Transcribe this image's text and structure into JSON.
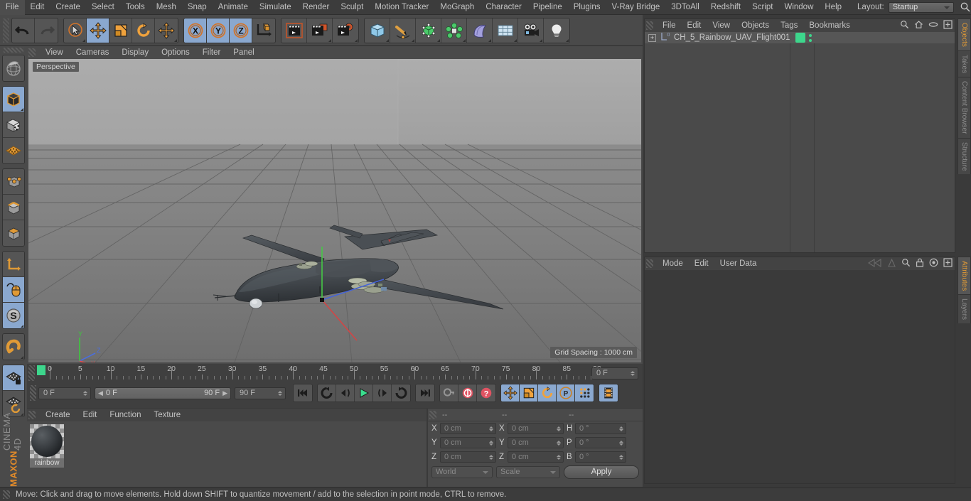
{
  "app": {
    "name": "MAXON CINEMA 4D",
    "brand_primary": "MAXON",
    "brand_secondary": "CINEMA 4D"
  },
  "menubar": {
    "items": [
      "File",
      "Edit",
      "Create",
      "Select",
      "Tools",
      "Mesh",
      "Snap",
      "Animate",
      "Simulate",
      "Render",
      "Sculpt",
      "Motion Tracker",
      "MoGraph",
      "Character",
      "Pipeline",
      "Plugins",
      "V-Ray Bridge",
      "3DToAll",
      "Redshift",
      "Script",
      "Window",
      "Help"
    ],
    "layout_label": "Layout:",
    "layout_value": "Startup",
    "search_icon": "search-icon"
  },
  "toolbar": {
    "groups": [
      {
        "name": "undo-redo",
        "buttons": [
          {
            "name": "undo-button",
            "icon": "undo-arrow-icon",
            "active": false
          },
          {
            "name": "redo-button",
            "icon": "redo-arrow-icon",
            "active": false
          }
        ]
      },
      {
        "name": "transform-tools",
        "buttons": [
          {
            "name": "live-selection-tool",
            "icon": "cursor-circle-icon",
            "active": false
          },
          {
            "name": "move-tool",
            "icon": "move-arrows-icon",
            "active": true
          },
          {
            "name": "scale-tool",
            "icon": "scale-box-icon",
            "active": false
          },
          {
            "name": "rotate-tool",
            "icon": "rotate-arc-icon",
            "active": false
          },
          {
            "name": "move-duplicate-tool",
            "icon": "move-arrows-icon",
            "active": false
          }
        ]
      },
      {
        "name": "axis-locks",
        "buttons": [
          {
            "name": "x-axis-lock",
            "icon": "x-circle-icon",
            "active": true
          },
          {
            "name": "y-axis-lock",
            "icon": "y-circle-icon",
            "active": true
          },
          {
            "name": "z-axis-lock",
            "icon": "z-circle-icon",
            "active": true
          },
          {
            "name": "world-object-coordinate-toggle",
            "icon": "axis-cube-icon",
            "active": false
          }
        ]
      },
      {
        "name": "render-tools",
        "buttons": [
          {
            "name": "render-view-button",
            "icon": "clapper-frame-icon",
            "active": false
          },
          {
            "name": "render-region-button",
            "icon": "clapper-region-icon",
            "active": false
          },
          {
            "name": "render-settings-button",
            "icon": "clapper-gear-icon",
            "active": false
          }
        ]
      },
      {
        "name": "create-objects",
        "buttons": [
          {
            "name": "add-primitive-cube-button",
            "icon": "blue-cube-icon",
            "active": false
          },
          {
            "name": "add-spline-button",
            "icon": "pen-spline-icon",
            "active": false
          },
          {
            "name": "add-generator-button",
            "icon": "green-cube-generator-icon",
            "active": false
          },
          {
            "name": "add-mograph-button",
            "icon": "green-cluster-icon",
            "active": false
          },
          {
            "name": "add-deformer-button",
            "icon": "purple-bend-icon",
            "active": false
          },
          {
            "name": "add-scene-object-button",
            "icon": "floor-grid-icon",
            "active": false
          },
          {
            "name": "add-camera-button",
            "icon": "camera-icon",
            "active": false
          },
          {
            "name": "add-light-button",
            "icon": "light-bulb-icon",
            "active": false
          }
        ]
      }
    ]
  },
  "leftbar": {
    "groups": [
      {
        "name": "render-preview",
        "buttons": [
          {
            "name": "interactive-render-region-button",
            "icon": "globe-sphere-icon",
            "active": false
          }
        ]
      },
      {
        "name": "mode-group-1",
        "buttons": [
          {
            "name": "object-mode-button",
            "icon": "dark-cube-icon",
            "active": true
          },
          {
            "name": "texture-mode-button",
            "icon": "checker-cube-icon",
            "active": false
          },
          {
            "name": "deformer-mode-button",
            "icon": "orange-grid-icon",
            "active": false
          }
        ]
      },
      {
        "name": "component-modes",
        "buttons": [
          {
            "name": "points-mode-button",
            "icon": "cube-points-icon",
            "active": false
          },
          {
            "name": "edges-mode-button",
            "icon": "cube-edges-icon",
            "active": false
          },
          {
            "name": "polygons-mode-button",
            "icon": "cube-polygon-icon",
            "active": false
          }
        ]
      },
      {
        "name": "axis-group",
        "buttons": [
          {
            "name": "enable-axis-modification-button",
            "icon": "axis-corner-icon",
            "active": false
          },
          {
            "name": "viewport-solo-button",
            "icon": "mouse-curve-icon",
            "active": true
          },
          {
            "name": "enable-snapping-button",
            "icon": "s-sphere-icon",
            "active": true
          }
        ]
      },
      {
        "name": "magnet-group",
        "buttons": [
          {
            "name": "magnet-tool-button",
            "icon": "magnet-icon",
            "active": false
          }
        ]
      },
      {
        "name": "workplane-group",
        "buttons": [
          {
            "name": "lock-workplane-button",
            "icon": "workplane-lock-icon",
            "active": true
          },
          {
            "name": "planar-workplane-button",
            "icon": "workplane-rotate-icon",
            "active": false
          }
        ]
      }
    ]
  },
  "viewport": {
    "menu_items": [
      "View",
      "Cameras",
      "Display",
      "Options",
      "Filter",
      "Panel"
    ],
    "view_label": "Perspective",
    "grid_spacing": "Grid Spacing : 1000 cm",
    "axis_gizmo": {
      "x": "X",
      "y": "Y",
      "z": "Z"
    },
    "scene_object": "UAV aircraft model"
  },
  "timeline": {
    "ruler_min": 0,
    "ruler_max": 90,
    "ruler_labels": [
      0,
      5,
      10,
      15,
      20,
      25,
      30,
      35,
      40,
      45,
      50,
      55,
      60,
      65,
      70,
      75,
      80,
      85,
      90
    ],
    "current_frame_field": "0 F",
    "preview_min": "0 F",
    "preview_max": "90 F",
    "end_frame_field": "90 F",
    "right_frame_field": "0 F",
    "playback_buttons": [
      {
        "name": "go-to-start-button",
        "icon": "skip-start-icon",
        "active": false
      },
      {
        "name": "go-to-previous-key-button",
        "icon": "prev-key-icon",
        "active": false
      },
      {
        "name": "step-back-button",
        "icon": "step-back-icon",
        "active": false
      },
      {
        "name": "play-button",
        "icon": "play-icon",
        "active": false
      },
      {
        "name": "step-forward-button",
        "icon": "step-forward-icon",
        "active": false
      },
      {
        "name": "go-to-next-key-button",
        "icon": "next-key-icon",
        "active": false
      },
      {
        "name": "go-to-end-button",
        "icon": "skip-end-icon",
        "active": false
      }
    ],
    "key_buttons": [
      {
        "name": "autokeying-button",
        "icon": "key-icon",
        "active": false
      },
      {
        "name": "record-active-objects-button",
        "icon": "record-circle-icon",
        "active": false
      },
      {
        "name": "keyframe-selection-button",
        "icon": "question-circle-icon",
        "active": false
      }
    ],
    "param_buttons": [
      {
        "name": "position-key-button",
        "icon": "move-arrows-icon",
        "active": true
      },
      {
        "name": "scale-key-button",
        "icon": "scale-box-icon",
        "active": true
      },
      {
        "name": "rotation-key-button",
        "icon": "rotate-arc-icon",
        "active": true
      },
      {
        "name": "parameter-key-button",
        "icon": "p-circle-icon",
        "active": true
      },
      {
        "name": "point-level-animation-button",
        "icon": "dots-grid-icon",
        "active": true
      }
    ],
    "extra_buttons": [
      {
        "name": "timeline-view-button",
        "icon": "filmstrip-icon",
        "active": true
      }
    ]
  },
  "material_manager": {
    "menu_items": [
      "Create",
      "Edit",
      "Function",
      "Texture"
    ],
    "materials": [
      {
        "name": "rainbow"
      }
    ]
  },
  "coordinates": {
    "headers": [
      "--",
      "--",
      "--"
    ],
    "rows": [
      {
        "label_a": "X",
        "value_a": "0 cm",
        "label_b": "X",
        "value_b": "0 cm",
        "label_c": "H",
        "value_c": "0 °"
      },
      {
        "label_a": "Y",
        "value_a": "0 cm",
        "label_b": "Y",
        "value_b": "0 cm",
        "label_c": "P",
        "value_c": "0 °"
      },
      {
        "label_a": "Z",
        "value_a": "0 cm",
        "label_b": "Z",
        "value_b": "0 cm",
        "label_c": "B",
        "value_c": "0 °"
      }
    ],
    "coord_system": "World",
    "transform_mode": "Scale",
    "apply_label": "Apply"
  },
  "object_manager": {
    "menu_items": [
      "File",
      "Edit",
      "View",
      "Objects",
      "Tags",
      "Bookmarks"
    ],
    "header_icons": [
      "search-icon",
      "home-icon",
      "ellipse-icon",
      "add-layer-icon"
    ],
    "objects": [
      {
        "name": "CH_5_Rainbow_UAV_Flight001",
        "expand": "+",
        "layer_badge": "0",
        "tag_color": "#3dd68c"
      }
    ]
  },
  "attribute_manager": {
    "menu_items": [
      "Mode",
      "Edit",
      "User Data"
    ],
    "header_icons": [
      "nav-left-icon",
      "nav-right-icon",
      "search-icon",
      "lock-icon",
      "target-icon",
      "add-icon"
    ]
  },
  "side_tabs_top": [
    "Objects",
    "Takes",
    "Content Browser",
    "Structure"
  ],
  "side_tabs_bottom": [
    "Attributes",
    "Layers"
  ],
  "statusbar": {
    "message": "Move: Click and drag to move elements. Hold down SHIFT to quantize movement / add to the selection in point mode, CTRL to remove."
  },
  "colors": {
    "accent_orange": "#e09a36",
    "active_blue": "#8aa8cf",
    "tag_green": "#3dd68c",
    "axis_x": "#d24b4b",
    "axis_y": "#4bd24b",
    "axis_z": "#4b6bd2",
    "panel_bg": "#4a4a4a",
    "window_bg": "#3a3a3a"
  }
}
